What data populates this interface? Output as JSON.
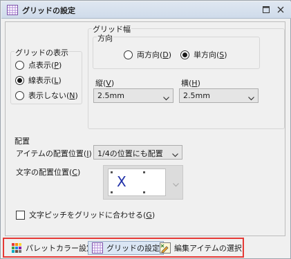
{
  "window": {
    "title": "グリッドの設定"
  },
  "grid_display": {
    "label": "グリッドの表示",
    "options": [
      {
        "label": "点表示(",
        "key": "P",
        "suffix": ")",
        "selected": false
      },
      {
        "label": "線表示(",
        "key": "L",
        "suffix": ")",
        "selected": true
      },
      {
        "label": "表示しない(",
        "key": "N",
        "suffix": ")",
        "selected": false
      }
    ]
  },
  "grid_width": {
    "label": "グリッド幅",
    "direction": {
      "label": "方向",
      "options": [
        {
          "label": "両方向(",
          "key": "D",
          "suffix": ")",
          "selected": false
        },
        {
          "label": "単方向(",
          "key": "S",
          "suffix": ")",
          "selected": true
        }
      ]
    },
    "vertical": {
      "label": "縦(",
      "key": "V",
      "suffix": ")",
      "value": "2.5mm"
    },
    "horizontal": {
      "label": "横(",
      "key": "H",
      "suffix": ")",
      "value": "2.5mm"
    }
  },
  "layout": {
    "label": "配置",
    "item_position": {
      "label": "アイテムの配置位置(",
      "key": "I",
      "suffix": ")",
      "value": "1/4の位置にも配置"
    },
    "text_position": {
      "label": "文字の配置位置(",
      "key": "C",
      "suffix": ")",
      "preview_char": "X"
    },
    "pitch_checkbox": {
      "label": "文字ピッチをグリッドに合わせる(",
      "key": "G",
      "suffix": ")",
      "checked": false
    }
  },
  "tabs": [
    {
      "label": "パレットカラー設定",
      "icon": "palette-icon",
      "active": false
    },
    {
      "label": "グリッドの設定",
      "icon": "grid-icon",
      "active": true
    },
    {
      "label": "編集アイテムの選択",
      "icon": "edit-select-icon",
      "active": false
    }
  ]
}
